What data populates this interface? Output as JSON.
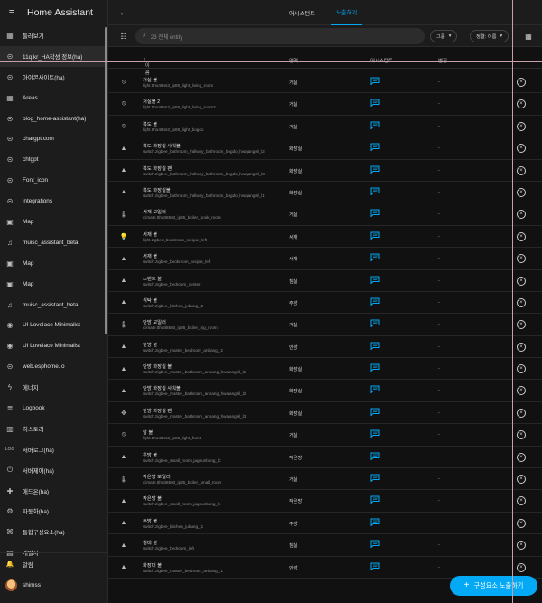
{
  "sidebar": {
    "title": "Home Assistant",
    "items": [
      {
        "label": "둘러보기",
        "icon": "dashboard-icon",
        "glyph": "▦"
      },
      {
        "label": "11q.kr_HA작성 정보(ha)",
        "icon": "link-icon",
        "glyph": "⊝"
      },
      {
        "label": "아이콘사이트(ha)",
        "icon": "link-icon",
        "glyph": "⊝"
      },
      {
        "label": "Areas",
        "icon": "dashboard-icon",
        "glyph": "▦"
      },
      {
        "label": "blog_home-assistant(ha)",
        "icon": "link-icon",
        "glyph": "⊝"
      },
      {
        "label": "chatgpt.com",
        "icon": "link-icon",
        "glyph": "⊝"
      },
      {
        "label": "chtgpt",
        "icon": "link-icon",
        "glyph": "⊝"
      },
      {
        "label": "Font_icon",
        "icon": "link-icon",
        "glyph": "⊝"
      },
      {
        "label": "integrations",
        "icon": "link-icon",
        "glyph": "⊝"
      },
      {
        "label": "Map",
        "icon": "map-icon",
        "glyph": "▣"
      },
      {
        "label": "muisc_assistant_beta",
        "icon": "music-icon",
        "glyph": "♫"
      },
      {
        "label": "Map",
        "icon": "map-icon",
        "glyph": "▣"
      },
      {
        "label": "Map",
        "icon": "map-icon",
        "glyph": "▣"
      },
      {
        "label": "muisc_assistant_beta",
        "icon": "music-icon",
        "glyph": "♫"
      },
      {
        "label": "UI Lovelace Minimalist",
        "icon": "lovelace-icon",
        "glyph": "◉"
      },
      {
        "label": "UI Lovelace Minimalist",
        "icon": "lovelace-icon",
        "glyph": "◉"
      },
      {
        "label": "web.esphome.io",
        "icon": "link-icon",
        "glyph": "⊝"
      },
      {
        "label": "에너지",
        "icon": "energy-icon",
        "glyph": "ϟ"
      },
      {
        "label": "Logbook",
        "icon": "logbook-icon",
        "glyph": "≣"
      },
      {
        "label": "히스토리",
        "icon": "history-icon",
        "glyph": "▥"
      },
      {
        "label": "서버로그(ha)",
        "icon": "log-icon",
        "glyph": "LOG"
      },
      {
        "label": "서버제어(ha)",
        "icon": "server-icon",
        "glyph": "⏻"
      },
      {
        "label": "애드온(ha)",
        "icon": "addon-icon",
        "glyph": "✚"
      },
      {
        "label": "자동화(ha)",
        "icon": "automation-icon",
        "glyph": "⚙"
      },
      {
        "label": "통합구성요소(ha)",
        "icon": "integration-icon",
        "glyph": "⌘"
      },
      {
        "label": "개발자",
        "icon": "developer-icon",
        "glyph": "▤"
      }
    ],
    "bottom": [
      {
        "label": "알림",
        "icon": "bell-icon",
        "glyph": "🔔"
      },
      {
        "label": "shimss",
        "icon": "avatar",
        "glyph": ""
      }
    ]
  },
  "topbar": {
    "tabs": [
      {
        "label": "어시스턴트",
        "active": false
      },
      {
        "label": "노출하기",
        "active": true
      }
    ]
  },
  "toolbar": {
    "search_placeholder": "23 전체 entity",
    "group_label": "그룹",
    "sort_label": "정렬: 이름"
  },
  "table": {
    "headers": {
      "name": "이름",
      "area": "영역",
      "assistant": "어시스턴트",
      "alias": "별칭"
    },
    "rows": [
      {
        "name": "거실 불",
        "entity": "light.ttho485s3_ip85_light_living_room",
        "area": "거실",
        "icon": "lamp-off-icon",
        "glyph": "⦸",
        "alias": "-"
      },
      {
        "name": "거실불 2",
        "entity": "light.ttho485s3_ip85_light_living_room2",
        "area": "거실",
        "icon": "lamp-off-icon",
        "glyph": "⦸",
        "alias": "-"
      },
      {
        "name": "복도 불",
        "entity": "light.ttho485s3_ip85_light_bogdo",
        "area": "거실",
        "icon": "lamp-off-icon",
        "glyph": "⦸",
        "alias": "-"
      },
      {
        "name": "복도 화장실 사워불",
        "entity": "switch.zigbee_bathroom_hallway_bathroom_bogdo_hwajangsil_l2",
        "area": "화장실",
        "icon": "ceiling-light-icon",
        "glyph": "▲",
        "alias": "-"
      },
      {
        "name": "복도 화장실 팬",
        "entity": "switch.zigbee_bathroom_hallway_bathroom_bogdo_hwajangsil_l3",
        "area": "화장실",
        "icon": "ceiling-light-icon",
        "glyph": "▲",
        "alias": "-"
      },
      {
        "name": "복도 화장실불",
        "entity": "switch.zigbee_bathroom_hallway_bathroom_bogdo_hwajangsil_l1",
        "area": "화장실",
        "icon": "ceiling-light-icon",
        "glyph": "▲",
        "alias": "-"
      },
      {
        "name": "서재 보일러",
        "entity": "climate.ttho485s3_ip85_boiler_book_room",
        "area": "거실",
        "icon": "thermostat-icon",
        "glyph": "🌡",
        "alias": "-"
      },
      {
        "name": "서재 불",
        "entity": "light.zigbee_bookroom_seojae_left",
        "area": "서재",
        "icon": "bulb-icon",
        "glyph": "💡",
        "alias": "-"
      },
      {
        "name": "서재 불",
        "entity": "switch.zigbee_bookroom_seojae_left",
        "area": "서재",
        "icon": "ceiling-light-icon",
        "glyph": "▲",
        "alias": "-"
      },
      {
        "name": "스탠드 불",
        "entity": "switch.zigbee_bedroom_center",
        "area": "침실",
        "icon": "ceiling-light-icon",
        "glyph": "▲",
        "alias": "-"
      },
      {
        "name": "식탁 불",
        "entity": "switch.zigbee_kitchen_jubang_l2",
        "area": "주방",
        "icon": "ceiling-light-icon",
        "glyph": "▲",
        "alias": "-"
      },
      {
        "name": "안방 보일러",
        "entity": "climate.ttho485s3_ip85_boiler_big_room",
        "area": "거실",
        "icon": "thermostat-icon",
        "glyph": "🌡",
        "alias": "-"
      },
      {
        "name": "안방 불",
        "entity": "switch.zigbee_master_bedroom_anbang_l2",
        "area": "안방",
        "icon": "ceiling-light-icon",
        "glyph": "▲",
        "alias": "-"
      },
      {
        "name": "안방 화장실 불",
        "entity": "switch.zigbee_master_bathroom_anbang_hwajangsil_l1",
        "area": "화장실",
        "icon": "ceiling-light-icon",
        "glyph": "▲",
        "alias": "-"
      },
      {
        "name": "안방 화장실 사워불",
        "entity": "switch.zigbee_master_bathroom_anbang_hwajangsil_l2",
        "area": "화장실",
        "icon": "ceiling-light-icon",
        "glyph": "▲",
        "alias": "-"
      },
      {
        "name": "안방 화장실 팬",
        "entity": "switch.zigbee_master_bathroom_anbang_hwajangsil_l3",
        "area": "화장실",
        "icon": "fan-icon",
        "glyph": "✥",
        "alias": "-"
      },
      {
        "name": "앞 불",
        "entity": "light.ttho485s3_ip85_light_front",
        "area": "거실",
        "icon": "lamp-off-icon",
        "glyph": "⦸",
        "alias": "-"
      },
      {
        "name": "옷방 불",
        "entity": "switch.zigbee_small_room_jageunbang_l2",
        "area": "작은방",
        "icon": "ceiling-light-icon",
        "glyph": "▲",
        "alias": "-"
      },
      {
        "name": "작은방 보일러",
        "entity": "climate.ttho485s3_ip85_boiler_small_room",
        "area": "거실",
        "icon": "thermostat-icon",
        "glyph": "🌡",
        "alias": "-"
      },
      {
        "name": "작은방 불",
        "entity": "switch.zigbee_small_room_jageunbang_l1",
        "area": "작은방",
        "icon": "ceiling-light-icon",
        "glyph": "▲",
        "alias": "-"
      },
      {
        "name": "주방 불",
        "entity": "switch.zigbee_kitchen_jubang_l1",
        "area": "주방",
        "icon": "ceiling-light-icon",
        "glyph": "▲",
        "alias": "-"
      },
      {
        "name": "침대 불",
        "entity": "switch.zigbee_bedroom_left",
        "area": "침실",
        "icon": "ceiling-light-icon",
        "glyph": "▲",
        "alias": "-"
      },
      {
        "name": "화장대 불",
        "entity": "switch.zigbee_master_bedroom_anbang_l1",
        "area": "안방",
        "icon": "ceiling-light-icon",
        "glyph": "▲",
        "alias": "-"
      }
    ]
  },
  "fab": {
    "label": "구성요소 노출하기"
  },
  "colors": {
    "accent": "#03a9f4",
    "background": "#111111",
    "sidebar": "#1c1c1c"
  }
}
